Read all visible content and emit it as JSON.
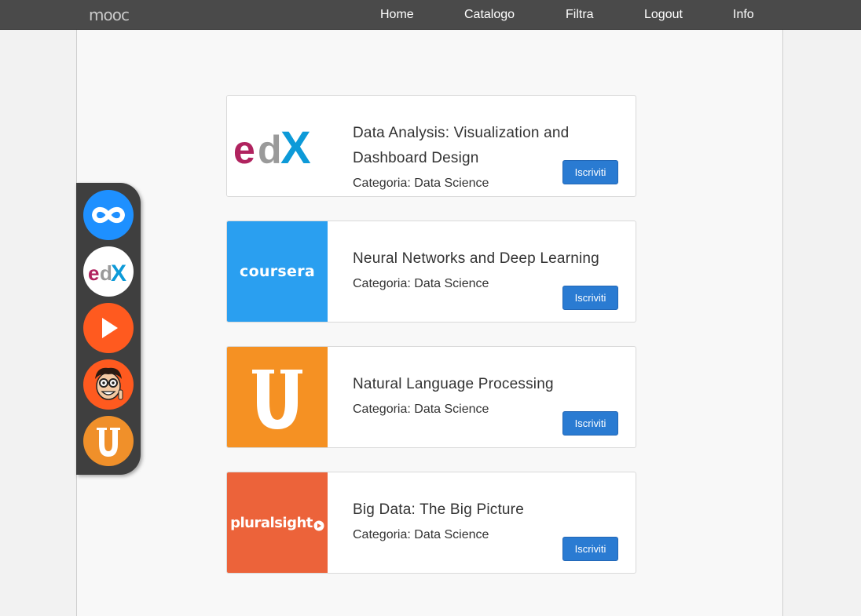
{
  "brand": {
    "logo": "mooc"
  },
  "nav": {
    "items": [
      {
        "label": "Home"
      },
      {
        "label": "Catalogo"
      },
      {
        "label": "Filtra"
      },
      {
        "label": "Logout"
      },
      {
        "label": "Info"
      }
    ]
  },
  "dock": {
    "providers": [
      {
        "icon": "infinity-icon",
        "color": "#1e90ff"
      },
      {
        "icon": "edx-icon",
        "color": "#ffffff"
      },
      {
        "icon": "play-icon",
        "color": "#ff5a1f"
      },
      {
        "icon": "cartoon-face-icon",
        "color": "#ff5a1f"
      },
      {
        "icon": "udemy-u-icon",
        "color": "#f0902a"
      }
    ]
  },
  "courses": [
    {
      "title": "Data Analysis: Visualization and Dashboard Design",
      "category": "Categoria: Data Science",
      "button": "Iscriviti",
      "provider_logo": "edx-logo"
    },
    {
      "title": "Neural Networks and Deep Learning",
      "category": "Categoria: Data Science",
      "button": "Iscriviti",
      "provider_logo": "coursera-logo",
      "logo_text": "coursera"
    },
    {
      "title": "Natural Language Processing",
      "category": "Categoria: Data Science",
      "button": "Iscriviti",
      "provider_logo": "udemy-u-logo"
    },
    {
      "title": "Big Data: The Big Picture",
      "category": "Categoria: Data Science",
      "button": "Iscriviti",
      "provider_logo": "pluralsight-logo",
      "logo_text": "pluralsight"
    }
  ],
  "colors": {
    "navbar": "#4a4a4a",
    "button": "#2a7bd2",
    "coursera": "#2a9ff0",
    "udemy": "#f59123",
    "pluralsight": "#ec633a"
  }
}
